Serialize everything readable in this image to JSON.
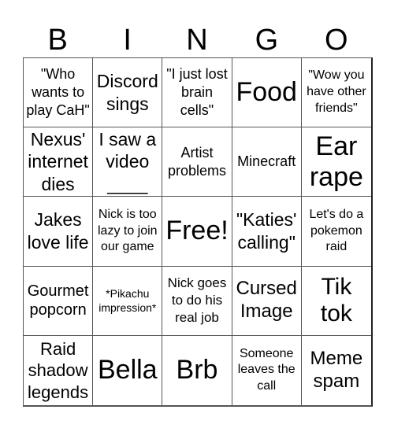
{
  "header": {
    "letters": [
      "B",
      "I",
      "N",
      "G",
      "O"
    ]
  },
  "card": {
    "rows": [
      [
        "\"Who wants to play CaH\"",
        "Discord sings",
        "\"I just lost brain cells\"",
        "Food",
        "\"Wow you have other friends\""
      ],
      [
        "Nexus' internet dies",
        "I saw a video ____",
        "Artist problems",
        "Minecraft",
        "Ear rape"
      ],
      [
        "Jakes love life",
        "Nick is too lazy to join our game",
        "Free!",
        "\"Katies' calling\"",
        "Let's do a pokemon raid"
      ],
      [
        "Gourmet popcorn",
        "*Pikachu impression*",
        "Nick goes to do his real job",
        "Cursed Image",
        "Tik tok"
      ],
      [
        "Raid shadow legends",
        "Bella",
        "Brb",
        "Someone leaves the call",
        "Meme spam"
      ]
    ]
  }
}
